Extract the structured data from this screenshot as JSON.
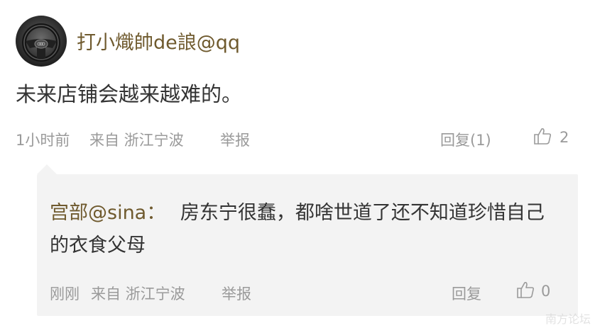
{
  "comment": {
    "username": "打小熾帥de誏@qq",
    "text": "未来店铺会越来越难的。",
    "time": "1小时前",
    "source": "来自 浙江宁波",
    "report_label": "举报",
    "reply_label": "回复(1)",
    "like_icon": "thumbs-up-icon",
    "like_count": "2"
  },
  "reply": {
    "username": "宫部@sina",
    "separator": "：",
    "text": "房东宁很蠢，都啥世道了还不知道珍惜自己的衣食父母",
    "time": "刚刚",
    "source": "来自 浙江宁波",
    "report_label": "举报",
    "reply_label": "回复",
    "like_icon": "thumbs-up-icon",
    "like_count": "0"
  },
  "colors": {
    "username": "#6f5a2e",
    "text": "#333333",
    "meta": "#9a9a9a",
    "reply_bg": "#f3f3f3"
  },
  "watermark": "南方论坛"
}
